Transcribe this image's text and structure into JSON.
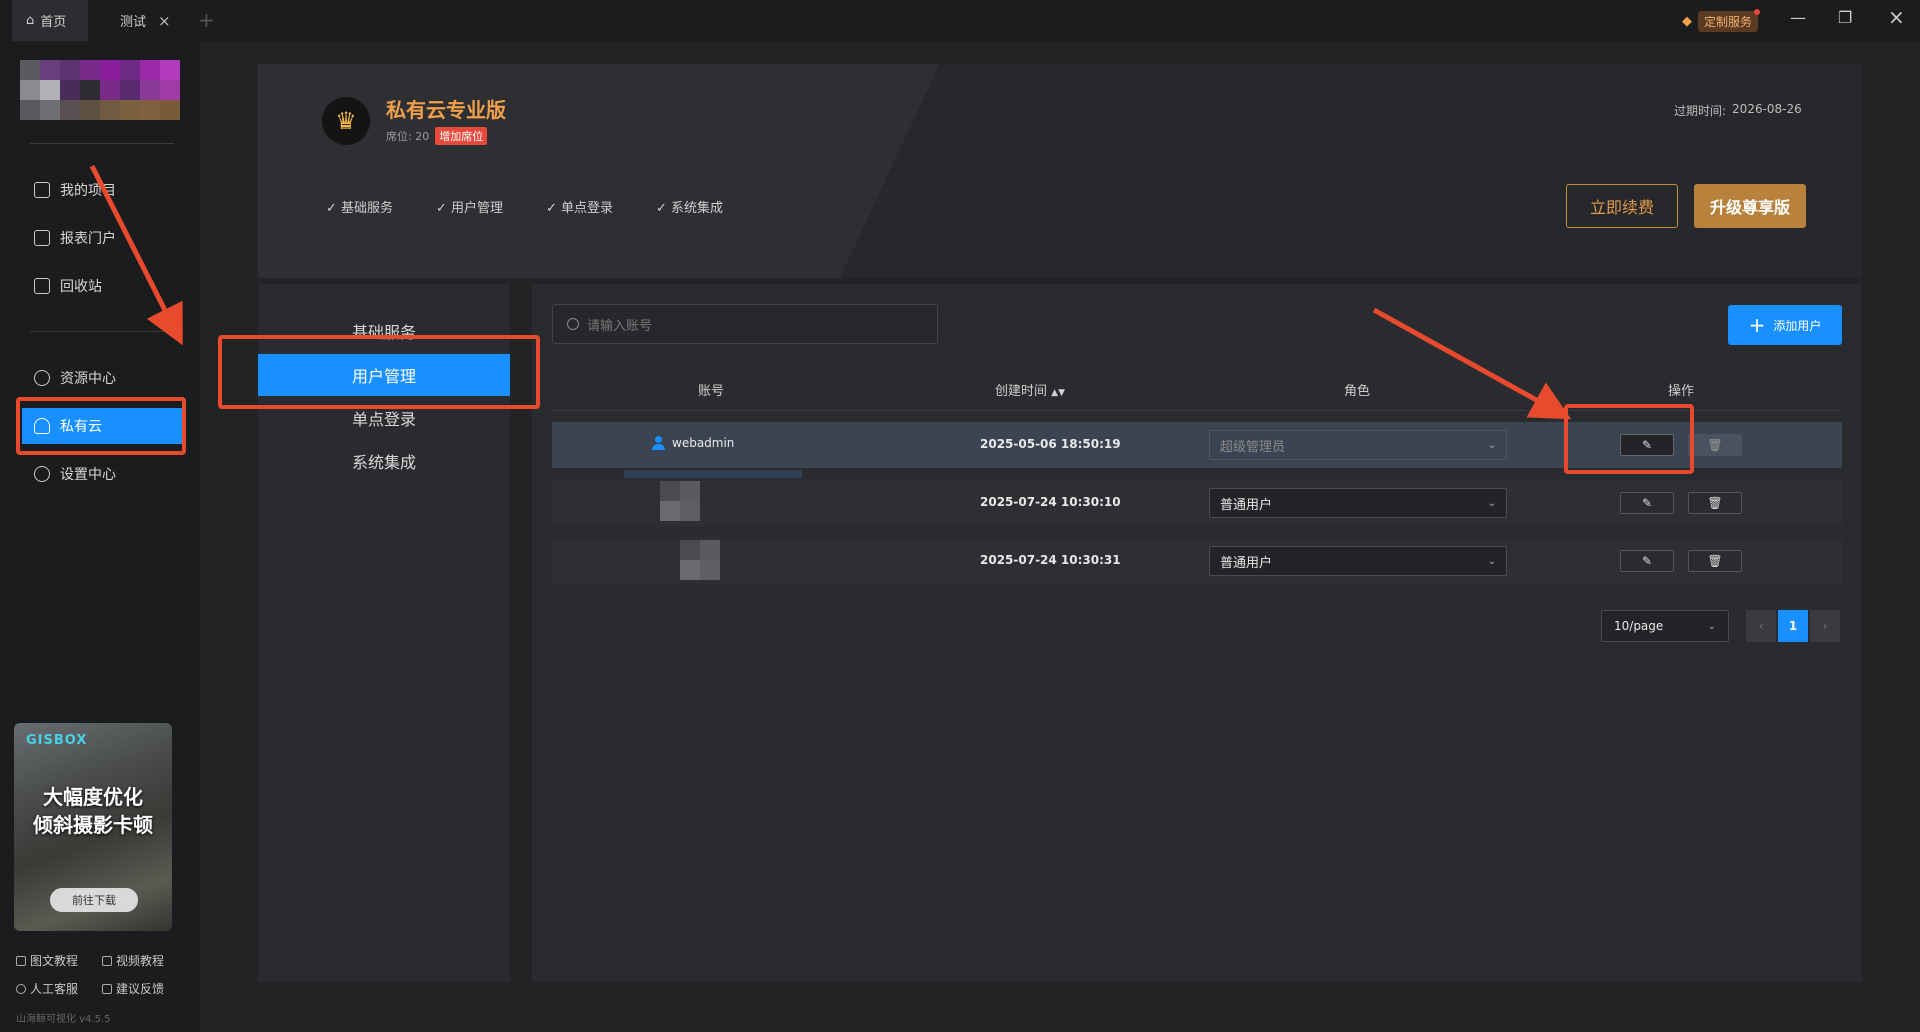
{
  "tabs": [
    {
      "label": "首页",
      "active": true
    },
    {
      "label": "测试",
      "active": false
    }
  ],
  "titlebar": {
    "custom_service": "定制服务"
  },
  "sidebar": {
    "items": [
      {
        "label": "我的项目",
        "icon": "chart-icon"
      },
      {
        "label": "报表门户",
        "icon": "report-icon"
      },
      {
        "label": "回收站",
        "icon": "trash-icon"
      },
      {
        "label": "资源中心",
        "icon": "cube-icon"
      },
      {
        "label": "私有云",
        "icon": "cloud-icon",
        "active": true
      },
      {
        "label": "设置中心",
        "icon": "gear-icon"
      }
    ],
    "promo": {
      "brand": "GISBOX",
      "line1": "大幅度优化",
      "line2": "倾斜摄影卡顿",
      "button": "前往下载"
    },
    "footer_links": [
      "图文教程",
      "视频教程",
      "人工客服",
      "建议反馈"
    ],
    "version": "山海鲸可视化 v4.5.5"
  },
  "plan": {
    "title": "私有云专业版",
    "seat_label": "席位: 20",
    "add_seat": "增加席位",
    "expire_label": "过期时间:",
    "expire_date": "2026-08-26",
    "features": [
      "基础服务",
      "用户管理",
      "单点登录",
      "系统集成"
    ],
    "renew_button": "立即续费",
    "upgrade_button": "升级尊享版"
  },
  "subnav": {
    "items": [
      "基础服务",
      "用户管理",
      "单点登录",
      "系统集成"
    ],
    "active_index": 1
  },
  "main": {
    "search_placeholder": "请输入账号",
    "add_user": "添加用户",
    "columns": [
      "账号",
      "创建时间",
      "角色",
      "操作"
    ],
    "rows": [
      {
        "account": "webadmin",
        "created": "2025-05-06 18:50:19",
        "role": "超级管理员"
      },
      {
        "account": "",
        "created": "2025-07-24 10:30:10",
        "role": "普通用户"
      },
      {
        "account": "",
        "created": "2025-07-24 10:30:31",
        "role": "普通用户"
      }
    ],
    "page_size": "10/page",
    "current_page": "1"
  },
  "colors": {
    "accent": "#1890ff",
    "gold": "#b8813c",
    "annotation": "#e84a2e"
  }
}
